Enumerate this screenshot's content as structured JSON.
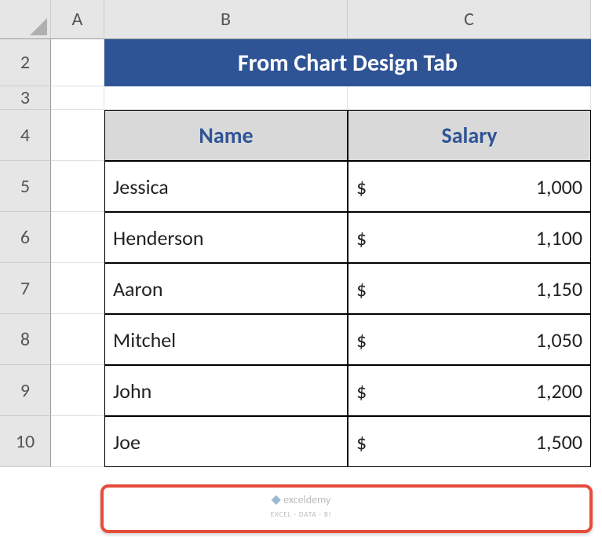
{
  "columns": [
    "A",
    "B",
    "C"
  ],
  "rows": [
    "2",
    "3",
    "4",
    "5",
    "6",
    "7",
    "8",
    "9",
    "10"
  ],
  "title": "From Chart Design Tab",
  "headers": {
    "name": "Name",
    "salary": "Salary"
  },
  "currency": "$",
  "data": [
    {
      "name": "Jessica",
      "salary": "1,000"
    },
    {
      "name": "Henderson",
      "salary": "1,100"
    },
    {
      "name": "Aaron",
      "salary": "1,150"
    },
    {
      "name": "Mitchel",
      "salary": "1,050"
    },
    {
      "name": "John",
      "salary": "1,200"
    },
    {
      "name": "Joe",
      "salary": "1,500"
    }
  ],
  "watermark": {
    "brand": "exceldemy",
    "tag": "EXCEL · DATA · BI"
  }
}
